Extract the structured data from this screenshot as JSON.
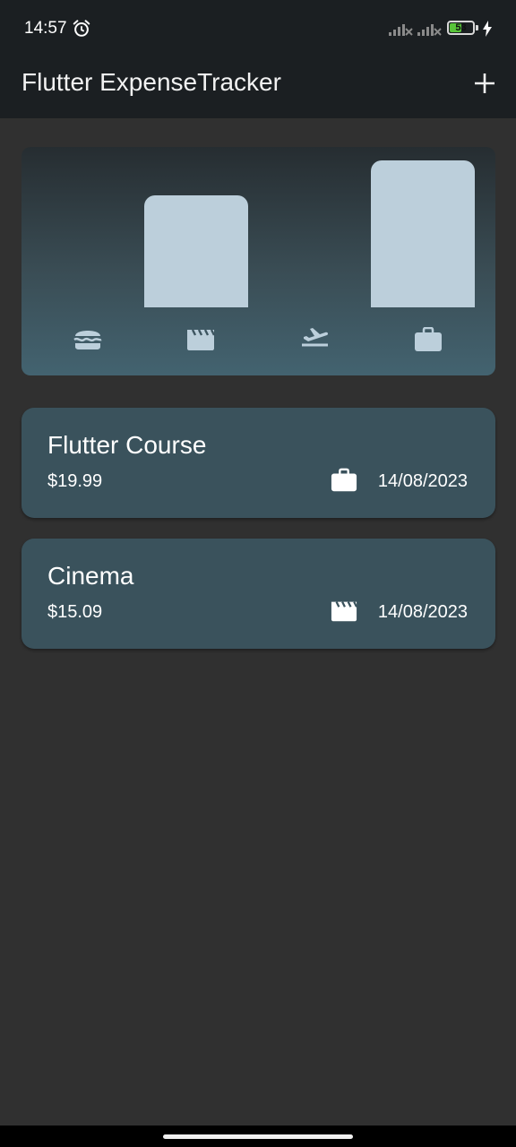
{
  "status_bar": {
    "time": "14:57",
    "battery_level": "53",
    "battery_fraction": 0.53,
    "icons": [
      "alarm-icon",
      "signal-x-icon",
      "signal-x-icon",
      "battery-icon",
      "charging-icon"
    ]
  },
  "app_bar": {
    "title": "Flutter ExpenseTracker",
    "action_icon": "add-icon"
  },
  "chart": {
    "bar_color": "#bccfdb",
    "categories": [
      {
        "icon": "food-icon",
        "fraction": 0.0
      },
      {
        "icon": "movie-icon",
        "fraction": 0.76
      },
      {
        "icon": "travel-icon",
        "fraction": 0.0
      },
      {
        "icon": "work-icon",
        "fraction": 1.0
      }
    ]
  },
  "expenses": [
    {
      "title": "Flutter Course",
      "amount": "$19.99",
      "date": "14/08/2023",
      "category_icon": "work-icon"
    },
    {
      "title": "Cinema",
      "amount": "$15.09",
      "date": "14/08/2023",
      "category_icon": "movie-icon"
    }
  ],
  "colors": {
    "background": "#303030",
    "app_bar": "#1b1f22",
    "card": "#3a525c",
    "accent_battery": "#58c43a"
  }
}
